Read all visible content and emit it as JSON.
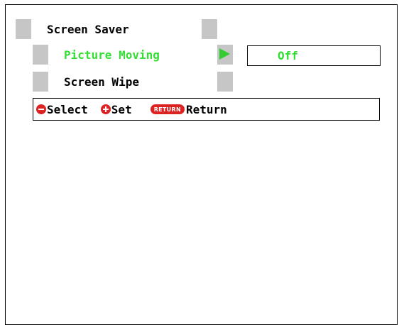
{
  "menu": {
    "title": "Screen Saver",
    "items": [
      {
        "label": "Picture Moving",
        "value": "Off"
      },
      {
        "label": "Screen Wipe"
      }
    ]
  },
  "hints": {
    "select": "Select",
    "set": "Set",
    "return_badge": "RETURN",
    "return": "Return"
  },
  "colors": {
    "highlight_text": "#33dd33",
    "bar_cap": "#c6c6c6",
    "button_red": "#dd2222"
  },
  "icons": {
    "select": "select-button-icon",
    "set": "set-button-icon",
    "return": "return-button-icon",
    "arrow": "arrow-right-icon"
  }
}
